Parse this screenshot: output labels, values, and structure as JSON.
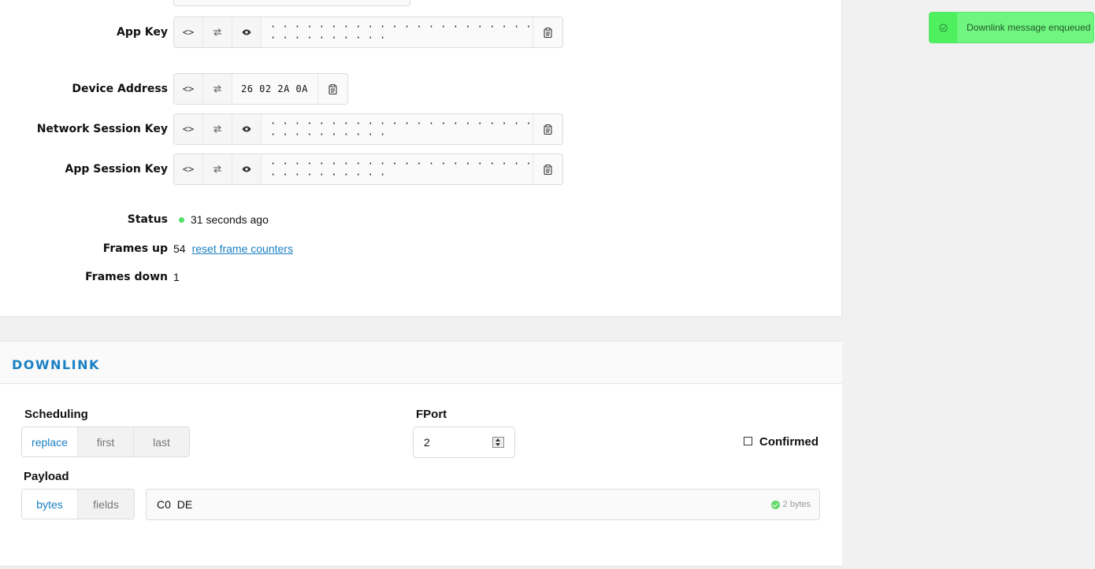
{
  "device": {
    "app_key": {
      "label": "App Key",
      "value": "· · · · · · · · · · · · · · · · · · · · · · · · · · · · · · · ·"
    },
    "device_address": {
      "label": "Device Address",
      "value": "26 02 2A 0A"
    },
    "network_session_key": {
      "label": "Network Session Key",
      "value": "· · · · · · · · · · · · · · · · · · · · · · · · · · · · · · · ·"
    },
    "app_session_key": {
      "label": "App Session Key",
      "value": "· · · · · · · · · · · · · · · · · · · · · · · · · · · · · · · ·"
    },
    "status": {
      "label": "Status",
      "value": "31 seconds ago",
      "color": "#53e06b"
    },
    "frames_up": {
      "label": "Frames up",
      "value": "54",
      "reset_link": "reset frame counters"
    },
    "frames_down": {
      "label": "Frames down",
      "value": "1"
    }
  },
  "downlink": {
    "title": "DOWNLINK",
    "scheduling": {
      "label": "Scheduling",
      "options": [
        "replace",
        "first",
        "last"
      ],
      "selected": "replace"
    },
    "fport": {
      "label": "FPort",
      "value": "2"
    },
    "confirmed": {
      "label": "Confirmed",
      "checked": false
    },
    "payload": {
      "label": "Payload",
      "modes": [
        "bytes",
        "fields"
      ],
      "selected": "bytes",
      "value": "C0 DE",
      "count": "2 bytes"
    }
  },
  "toast": {
    "message": "Downlink message enqueued",
    "color": "#6ff580"
  },
  "icons": [
    "code-toggle-icon",
    "byte-order-swap-icon",
    "eye-icon",
    "clipboard-icon",
    "check-circle-icon"
  ],
  "accent": "#1a80c4"
}
